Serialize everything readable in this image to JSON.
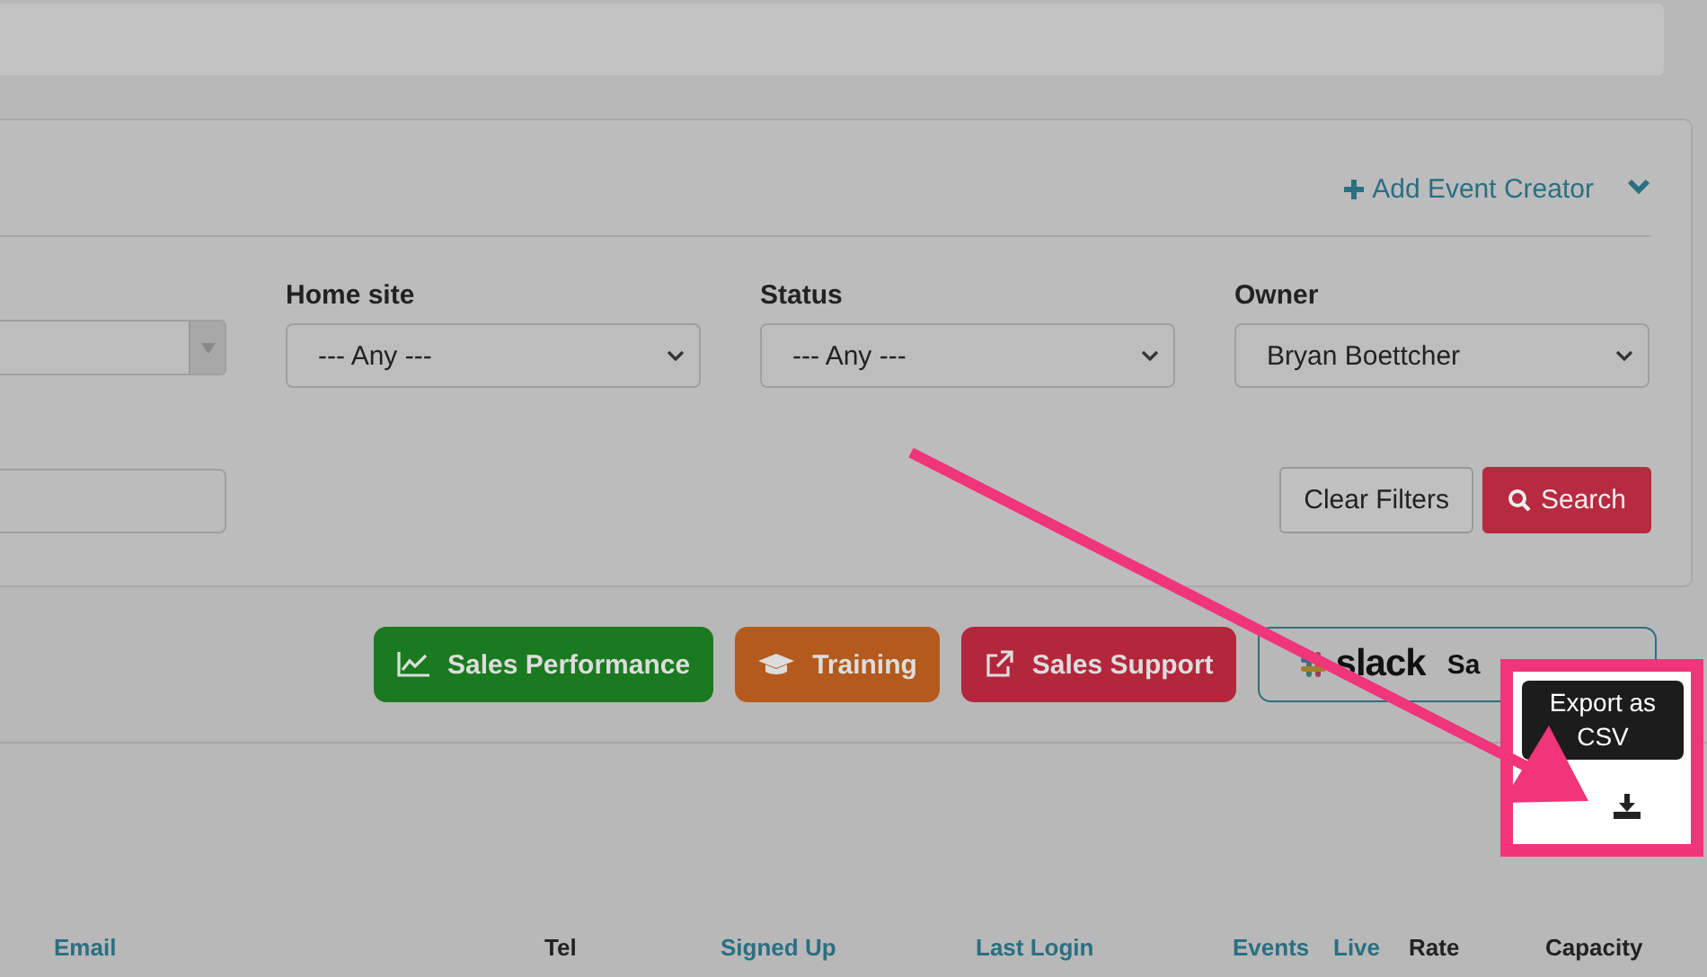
{
  "filter_panel": {
    "add_link": "Add Event Creator",
    "expanded": true,
    "filters": [
      {
        "kind": "combo"
      },
      {
        "kind": "select",
        "label": "Home site",
        "value": "--- Any ---"
      },
      {
        "kind": "select",
        "label": "Status",
        "value": "--- Any ---"
      },
      {
        "kind": "select",
        "label": "Owner",
        "value": "Bryan Boettcher"
      }
    ],
    "text_field": {
      "kind": "text"
    },
    "buttons": [
      {
        "label": "Clear Filters",
        "kind": "plain"
      },
      {
        "label": "Search",
        "kind": "danger"
      }
    ]
  },
  "link_buttons": [
    {
      "label": "Sales Performance",
      "kind": "filled",
      "color": "#1a7a1f"
    },
    {
      "label": "Training",
      "kind": "filled",
      "color": "#b35a1c"
    },
    {
      "label": "Sales Support",
      "kind": "filled",
      "color": "#b3263c"
    },
    {
      "label": "Sa",
      "kind": "outline",
      "logo_text": "slack",
      "color": "#2a6f82"
    }
  ],
  "export": {
    "tooltip": "Export as CSV"
  },
  "table": {
    "columns": [
      {
        "label": "Email",
        "sortable": true
      },
      {
        "label": "Tel",
        "sortable": false
      },
      {
        "label": "Signed Up",
        "sortable": true
      },
      {
        "label": "Last Login",
        "sortable": true
      },
      {
        "label": "Events",
        "sortable": true
      },
      {
        "label": "Live",
        "sortable": true
      },
      {
        "label": "Rate",
        "sortable": false
      },
      {
        "label": "Capacity",
        "sortable": false
      }
    ]
  }
}
